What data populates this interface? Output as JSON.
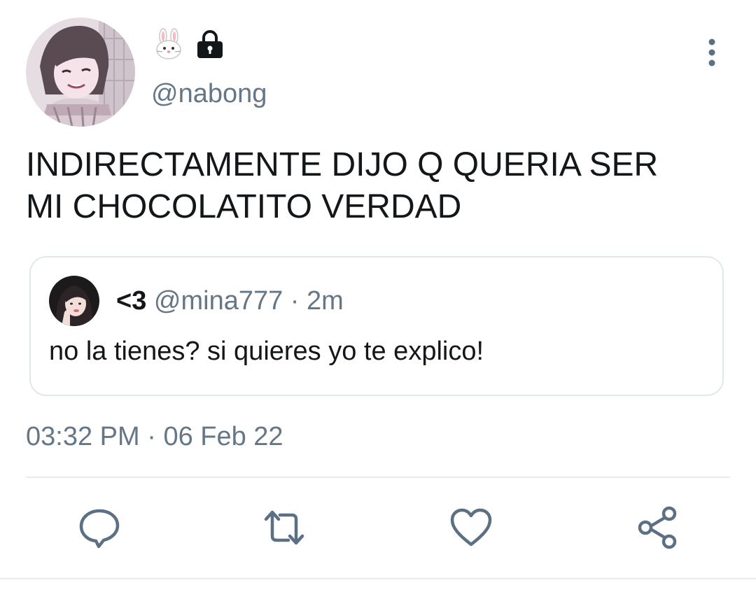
{
  "tweet": {
    "author": {
      "display_emoji_icon": "rabbit-face-icon",
      "lock_icon": "lock-icon",
      "handle": "@nabong",
      "avatar": "illustrated-girl-avatar"
    },
    "text_lines": [
      "INDIRECTAMENTE DIJO Q QUERIA SER",
      "MI CHOCOLATITO VERDAD"
    ],
    "timestamp": {
      "time": "03:32 PM",
      "separator": "·",
      "date": "06 Feb 22"
    },
    "menu_icon": "more-vertical-icon"
  },
  "quote": {
    "name": "<3",
    "handle": "@mina777",
    "separator": "·",
    "age": "2m",
    "text": "no la tienes? si quieres yo te explico!",
    "avatar": "photo-girl-avatar"
  },
  "actions": [
    {
      "name": "reply",
      "icon": "comment-icon"
    },
    {
      "name": "retweet",
      "icon": "retweet-icon"
    },
    {
      "name": "like",
      "icon": "heart-icon"
    },
    {
      "name": "share",
      "icon": "share-icon"
    }
  ],
  "colors": {
    "text": "#14171a",
    "secondary": "#657786",
    "icon": "#5b7083",
    "border": "#e1e8ed",
    "background": "#ffffff"
  }
}
